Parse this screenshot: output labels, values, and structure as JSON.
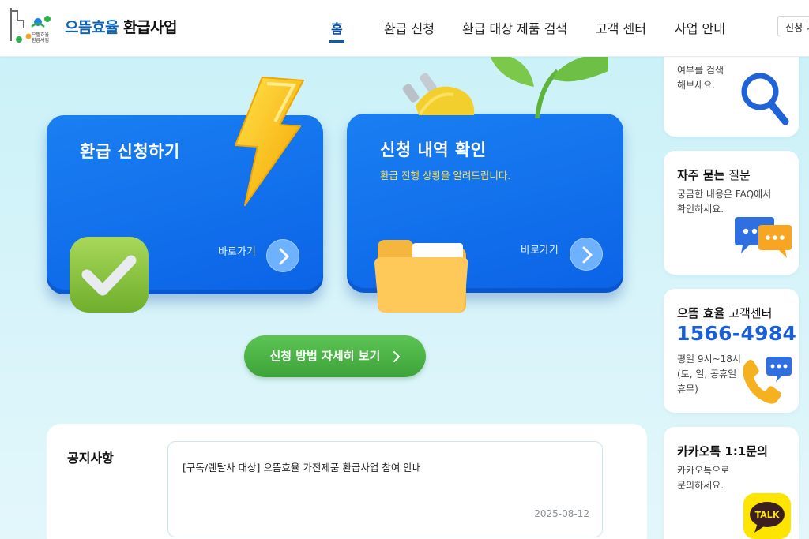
{
  "header": {
    "brand_part1": "으뜸효율",
    "brand_part2": "환급사업",
    "logo_text_line1": "으뜸효율",
    "logo_text_line2": "환급사업",
    "nav": [
      {
        "label": "홈",
        "active": true
      },
      {
        "label": "환급 신청"
      },
      {
        "label": "환급 대상 제품 검색"
      },
      {
        "label": "고객 센터"
      },
      {
        "label": "사업 안내"
      }
    ],
    "right_button": "신청 내"
  },
  "cards": [
    {
      "title": "환급 신청하기",
      "link": "바로가기"
    },
    {
      "title": "신청 내역 확인",
      "subtitle": "환급 진행 상황을 알려드립니다.",
      "link": "바로가기"
    }
  ],
  "cta": {
    "label": "신청 방법 자세히 보기"
  },
  "notice": {
    "title": "공지사항",
    "items": [
      {
        "text": "[구독/렌탈사 대상] 으뜸효율 가전제품 환급사업 참여 안내",
        "date": "2025-08-12"
      }
    ]
  },
  "side": {
    "search": {
      "desc_line1": "여부를 검색",
      "desc_line2": "해보세요."
    },
    "faq": {
      "title_bold": "자주 묻는",
      "title_rest": "질문",
      "desc_line1": "궁금한 내용은 FAQ에서",
      "desc_line2": "확인하세요."
    },
    "callcenter": {
      "title_bold": "으뜸 효율",
      "title_rest": "고객센터",
      "phone": "1566-4984",
      "hours_line1": "평일 9시~18시",
      "hours_line2": "(토, 일, 공휴일",
      "hours_line3": "휴무)"
    },
    "kakao": {
      "title": "카카오톡 1:1문의",
      "desc_line1": "카카오톡으로",
      "desc_line2": "문의하세요.",
      "talk": "TALK"
    }
  },
  "colors": {
    "primary_blue": "#0b63e6",
    "brand_blue": "#0c63b8",
    "green": "#4cb447",
    "sub_yellow": "#ffe14a",
    "kakao_yellow": "#fee500",
    "background": "#c8f1f8"
  },
  "icons": [
    "logo-icon",
    "lightning-icon",
    "plug-icon",
    "leaf-icon",
    "check-icon",
    "folder-icon",
    "chevron-right-icon",
    "magnifier-icon",
    "chat-bubbles-icon",
    "phone-icon",
    "kakao-talk-icon"
  ]
}
